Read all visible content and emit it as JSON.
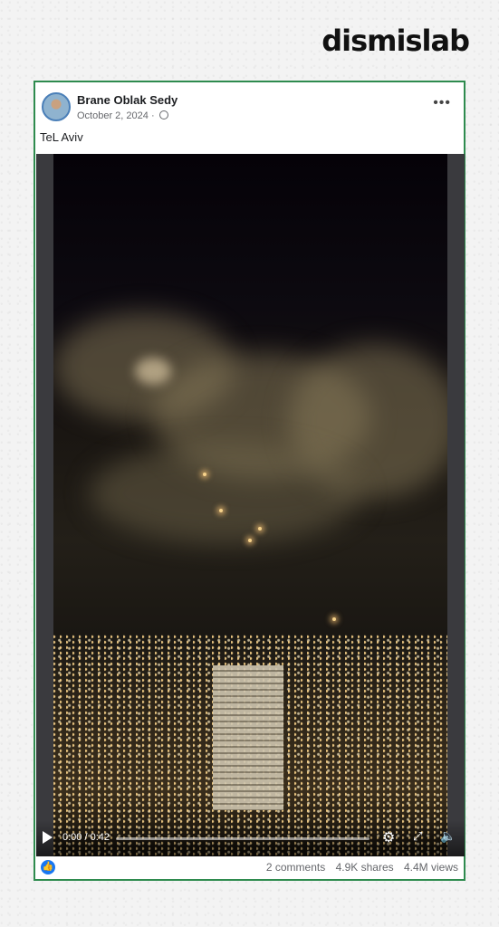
{
  "brand": "dismislab",
  "post": {
    "author": "Brane Oblak Sedy",
    "date": "October 2, 2024",
    "separator": "·",
    "caption": "TeL Aviv",
    "more_icon": "more-dots-icon"
  },
  "video": {
    "time": "0:00 / 0:42",
    "progress_fraction": 0.0,
    "controls": [
      "play-icon",
      "settings-icon",
      "fullscreen-icon",
      "mute-icon"
    ]
  },
  "stats": {
    "comments": "2 comments",
    "shares": "4.9K shares",
    "views": "4.4M views"
  },
  "colors": {
    "border": "#2e8b4e",
    "like_blue": "#1877f2"
  }
}
